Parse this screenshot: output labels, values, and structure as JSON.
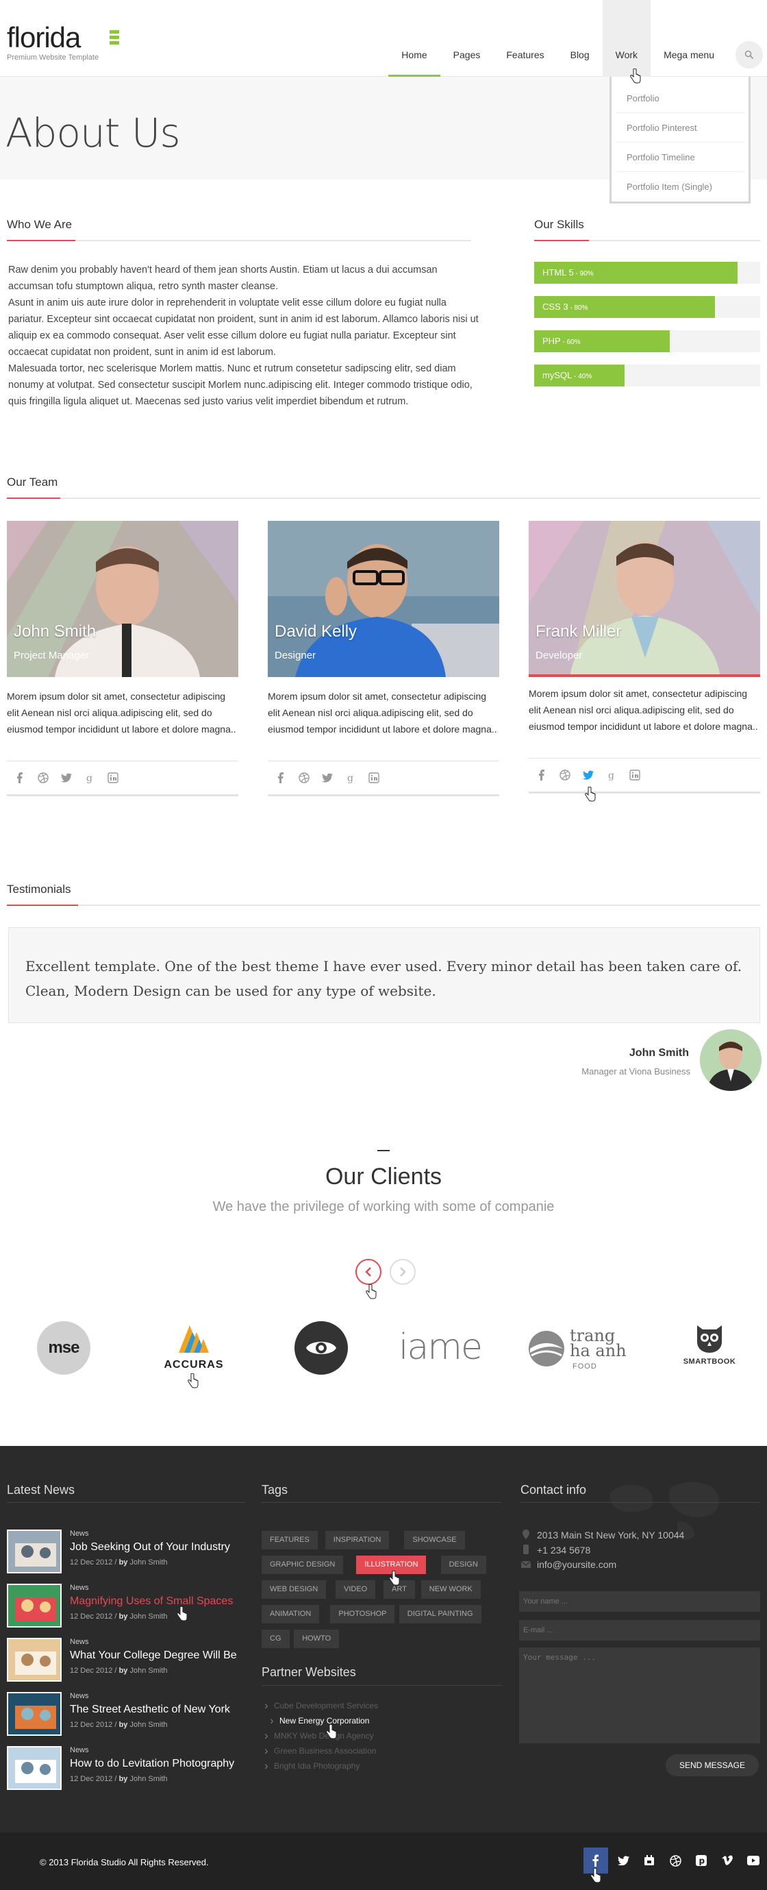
{
  "brand": {
    "name": "florida",
    "tagline": "Premium Website Template",
    "accent": "#8cc63f",
    "red": "#e44a52"
  },
  "nav": {
    "items": [
      "Home",
      "Pages",
      "Features",
      "Blog",
      "Work",
      "Mega menu"
    ],
    "active": "Home",
    "hover": "Work",
    "search_icon": "search-icon"
  },
  "work_dropdown": [
    "Portfolio",
    "Portfolio Pinterest",
    "Portfolio Timeline",
    "Portfolio Item (Single)"
  ],
  "page_title": "About Us",
  "who_we_are": {
    "heading": "Who We Are",
    "paragraphs": [
      "Raw denim you probably haven't heard of them jean shorts Austin. Etiam ut lacus a dui accumsan accumsan tofu stumptown aliqua, retro synth master cleanse.",
      "Asunt in anim uis aute irure dolor in reprehenderit in voluptate velit esse cillum dolore eu fugiat nulla pariatur. Excepteur sint occaecat cupidatat non proident, sunt in anim id est laborum. Allamco laboris nisi ut aliquip ex ea commodo consequat. Aser velit esse cillum dolore eu fugiat nulla pariatur. Excepteur sint occaecat cupidatat non proident, sunt in anim id est laborum.",
      "Malesuada tortor, nec scelerisque Morlem mattis. Nunc et rutrum consetetur sadipscing elitr, sed diam nonumy at volutpat. Sed consectetur suscipit Morlem nunc.adipiscing elit. Integer commodo tristique odio, quis fringilla ligula aliquet ut. Maecenas sed justo varius velit imperdiet bibendum et rutrum."
    ]
  },
  "skills": {
    "heading": "Our Skills",
    "items": [
      {
        "name": "HTML 5",
        "label": "90%",
        "value": 0.9
      },
      {
        "name": "CSS 3",
        "label": "80%",
        "value": 0.8
      },
      {
        "name": "PHP",
        "label": "60%",
        "value": 0.6
      },
      {
        "name": "mySQL",
        "label": "40%",
        "value": 0.4
      }
    ]
  },
  "team": {
    "heading": "Our Team",
    "members": [
      {
        "name": "John Smith",
        "role": "Project Manager",
        "desc": "Morem ipsum dolor sit amet, consectetur adipiscing elit Aenean nisl orci aliqua.adipiscing elit, sed do eiusmod tempor incididunt ut labore et dolore magna.."
      },
      {
        "name": "David Kelly",
        "role": "Designer",
        "desc": "Morem ipsum dolor sit amet, consectetur adipiscing elit Aenean nisl orci aliqua.adipiscing elit, sed do eiusmod tempor incididunt ut labore et dolore magna.."
      },
      {
        "name": "Frank Miller",
        "role": "Developer",
        "desc": "Morem ipsum dolor sit amet, consectetur adipiscing elit Aenean nisl orci aliqua.adipiscing elit, sed do eiusmod tempor incididunt ut labore et dolore magna.."
      }
    ],
    "social_icons": [
      "facebook-icon",
      "dribbble-icon",
      "twitter-icon",
      "google-plus-icon",
      "linkedin-icon"
    ]
  },
  "testimonials": {
    "heading": "Testimonials",
    "quote": "Excellent template. One of the best theme I have ever used. Every minor detail has been taken care of. Clean, Modern Design can be used for any type of website.",
    "author": "John Smith",
    "position": "Manager at Viona Business"
  },
  "clients": {
    "heading": "Our Clients",
    "subheading": "We have the privilege of working with some of companie",
    "logos": [
      "mse",
      "ACCURAS",
      "",
      "iame",
      "trang ha anh",
      "SMARTBOOK"
    ],
    "logo_food": "FOOD"
  },
  "footer": {
    "news_heading": "Latest News",
    "news": [
      {
        "cat": "News",
        "title": "Job Seeking Out of Your Industry",
        "date": "12 Dec 2012 /",
        "by": "by",
        "author": "John Smith"
      },
      {
        "cat": "News",
        "title": "Magnifying Uses of Small Spaces",
        "date": "12 Dec 2012 /",
        "by": "by",
        "author": "John Smith"
      },
      {
        "cat": "News",
        "title": "What Your College Degree Will Be",
        "date": "12 Dec 2012 /",
        "by": "by",
        "author": "John Smith"
      },
      {
        "cat": "News",
        "title": "The Street Aesthetic of New York",
        "date": "12 Dec 2012 /",
        "by": "by",
        "author": "John Smith"
      },
      {
        "cat": "News",
        "title": "How to do Levitation Photography",
        "date": "12 Dec 2012 /",
        "by": "by",
        "author": "John Smith"
      }
    ],
    "tags_heading": "Tags",
    "tags": [
      "FEATURES",
      "INSPIRATION",
      "SHOWCASE",
      "GRAPHIC DESIGN",
      "ILLUSTRATION",
      "DESIGN",
      "WEB DESIGN",
      "VIDEO",
      "ART",
      "NEW WORK",
      "ANIMATION",
      "PHOTOSHOP",
      "DIGITAL PAINTING",
      "CG",
      "HOWTO"
    ],
    "active_tag": "ILLUSTRATION",
    "partners_heading": "Partner Websites",
    "partners": [
      "Cube Development Services",
      "New Energy Corporation",
      "MNKY Web Design Agency",
      "Green Business Association",
      "Bright Idia Photography"
    ],
    "contact_heading": "Contact info",
    "address": "2013 Main St New York, NY 10044",
    "phone": "+1 234 5678",
    "email": "info@yoursite.com",
    "form": {
      "name_ph": "Your name ...",
      "email_ph": "E-mail ...",
      "message_ph": "Your message ...",
      "send": "SEND MESSAGE"
    },
    "copyright": "© 2013 Florida Studio All Rights Reserved.",
    "social": [
      "facebook-icon",
      "twitter-icon",
      "delicious-icon",
      "dribbble-icon",
      "pinterest-icon",
      "vimeo-icon",
      "youtube-icon"
    ]
  }
}
